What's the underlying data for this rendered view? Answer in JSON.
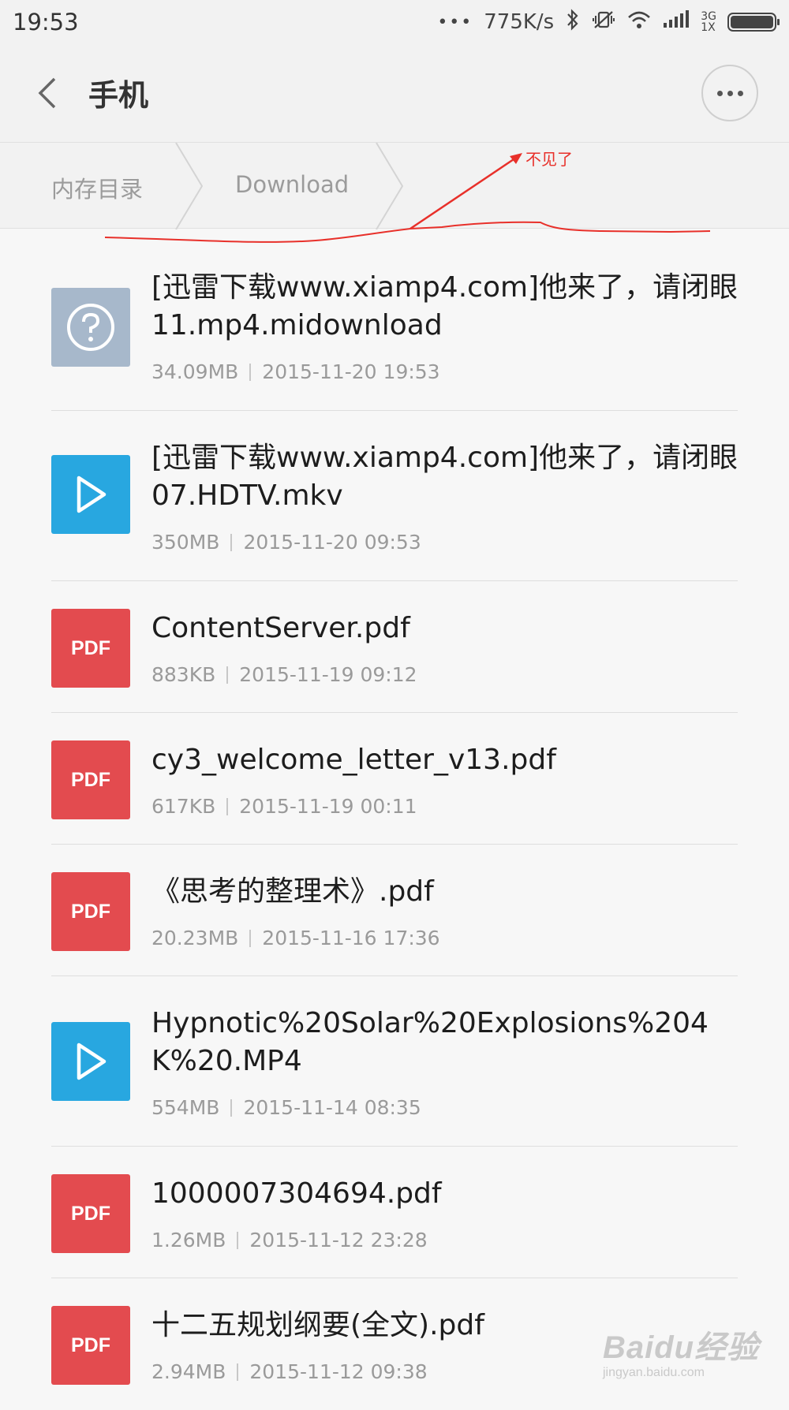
{
  "status_bar": {
    "time": "19:53",
    "dots": "•••",
    "speed": "775K/s",
    "network_top": "3G",
    "network_bottom": "1X",
    "icons": [
      "bluetooth-icon",
      "mute-vibrate-icon",
      "wifi-icon",
      "signal-icon",
      "battery-icon"
    ]
  },
  "header": {
    "title": "手机",
    "back_icon": "chevron-left-icon",
    "more_icon": "more-dots-icon"
  },
  "breadcrumb": {
    "items": [
      "内存目录",
      "Download"
    ]
  },
  "annotation": {
    "text": "不见了",
    "color": "#e8302a"
  },
  "files": [
    {
      "name": "[迅雷下载www.xiamp4.com]他来了，请闭眼11.mp4.midownload",
      "size": "34.09MB",
      "date": "2015-11-20 19:53",
      "type": "unknown",
      "icon": "question-file-icon"
    },
    {
      "name": "[迅雷下载www.xiamp4.com]他来了，请闭眼07.HDTV.mkv",
      "size": "350MB",
      "date": "2015-11-20 09:53",
      "type": "video",
      "icon": "video-play-icon"
    },
    {
      "name": "ContentServer.pdf",
      "size": "883KB",
      "date": "2015-11-19 09:12",
      "type": "pdf",
      "icon": "pdf-icon"
    },
    {
      "name": "cy3_welcome_letter_v13.pdf",
      "size": "617KB",
      "date": "2015-11-19 00:11",
      "type": "pdf",
      "icon": "pdf-icon"
    },
    {
      "name": "《思考的整理术》.pdf",
      "size": "20.23MB",
      "date": "2015-11-16 17:36",
      "type": "pdf",
      "icon": "pdf-icon"
    },
    {
      "name": "Hypnotic%20Solar%20Explosions%204K%20.MP4",
      "size": "554MB",
      "date": "2015-11-14 08:35",
      "type": "video",
      "icon": "video-play-icon"
    },
    {
      "name": "1000007304694.pdf",
      "size": "1.26MB",
      "date": "2015-11-12 23:28",
      "type": "pdf",
      "icon": "pdf-icon"
    },
    {
      "name": "十二五规划纲要(全文).pdf",
      "size": "2.94MB",
      "date": "2015-11-12 09:38",
      "type": "pdf",
      "icon": "pdf-icon"
    }
  ],
  "pdf_label": "PDF",
  "watermark": {
    "main": "Baidu经验",
    "sub": "jingyan.baidu.com"
  },
  "colors": {
    "pdf": "#e34b4f",
    "video": "#28a7e0",
    "unknown": "#a7b8cb"
  }
}
